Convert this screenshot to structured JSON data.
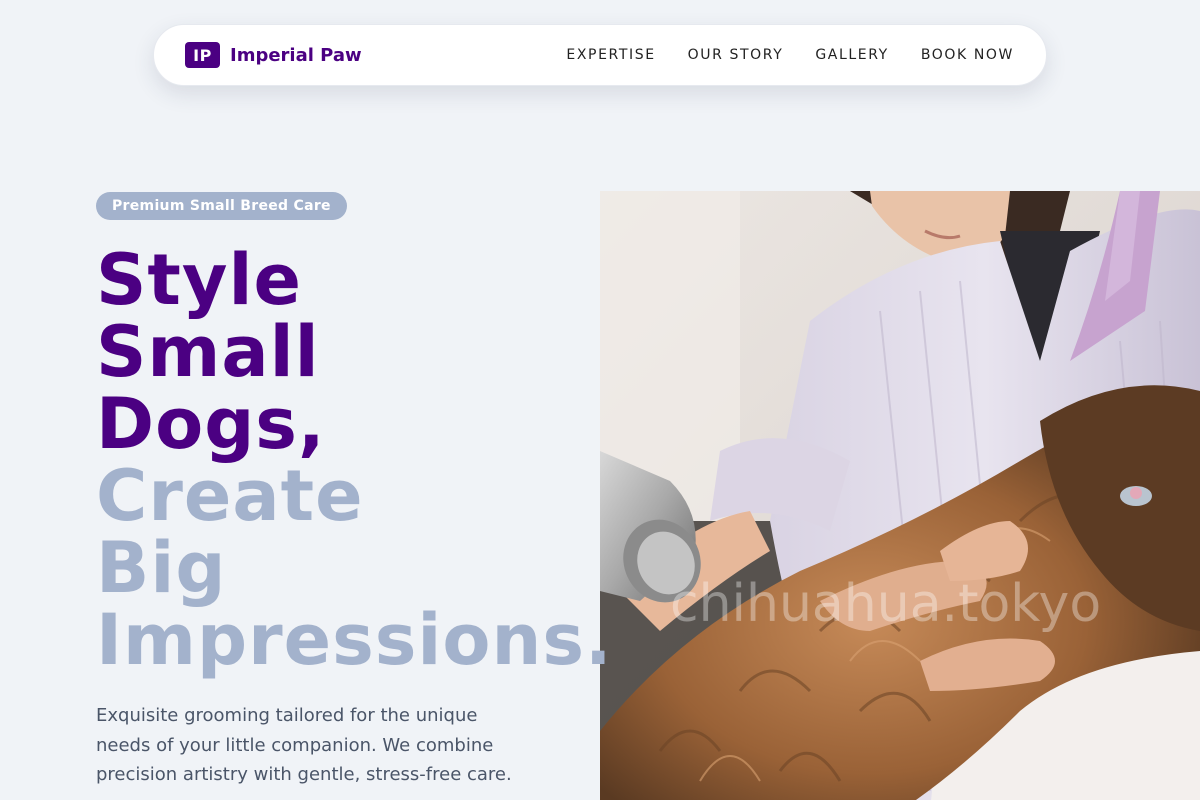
{
  "nav": {
    "logo_mark": "IP",
    "brand_name": "Imperial Paw",
    "links": [
      {
        "label": "EXPERTISE"
      },
      {
        "label": "OUR STORY"
      },
      {
        "label": "GALLERY"
      },
      {
        "label": "BOOK NOW"
      }
    ]
  },
  "hero": {
    "badge": "Premium Small Breed Care",
    "headline_primary": [
      "Style",
      "Small",
      "Dogs,"
    ],
    "headline_secondary": [
      "Create",
      "Big",
      "Impressions."
    ],
    "lede": "Exquisite grooming tailored for the unique needs of your little companion. We combine precision artistry with gentle, stress-free care.",
    "image_watermark": "chihuahua.tokyo"
  },
  "colors": {
    "brand_purple": "#4b0082",
    "muted_blue": "#a3b2cc",
    "background": "#f0f3f7",
    "body_text": "#4a5568"
  }
}
